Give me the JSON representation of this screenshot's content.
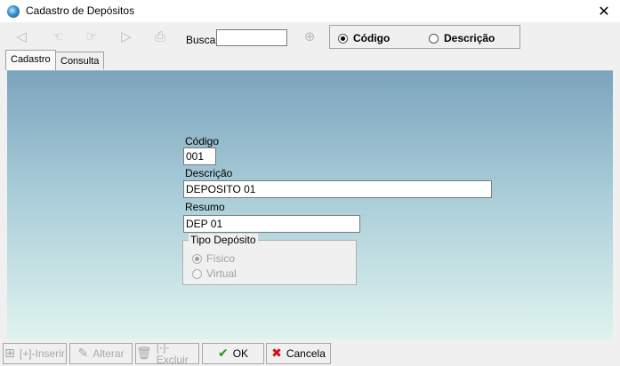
{
  "window": {
    "title": "Cadastro de Depósitos",
    "close": "✕"
  },
  "toolbar": {
    "busca_label": "Busca",
    "busca_value": "",
    "radio_codigo": "Código",
    "radio_descricao": "Descrição",
    "selected": "Código"
  },
  "tabs": [
    {
      "label": "Cadastro",
      "active": true
    },
    {
      "label": "Consulta",
      "active": false
    }
  ],
  "form": {
    "codigo_label": "Código",
    "codigo_value": "001",
    "descricao_label": "Descrição",
    "descricao_value": "DEPOSITO 01",
    "resumo_label": "Resumo",
    "resumo_value": "DEP 01",
    "tipo_label": "Tipo Depósito",
    "tipo_fisico": "Físico",
    "tipo_virtual": "Virtual",
    "tipo_selected": "Físico"
  },
  "buttons": {
    "inserir": "[+]-Inserir",
    "alterar": "Alterar",
    "excluir": "[-]-Excluir",
    "ok": "OK",
    "cancela": "Cancela"
  }
}
